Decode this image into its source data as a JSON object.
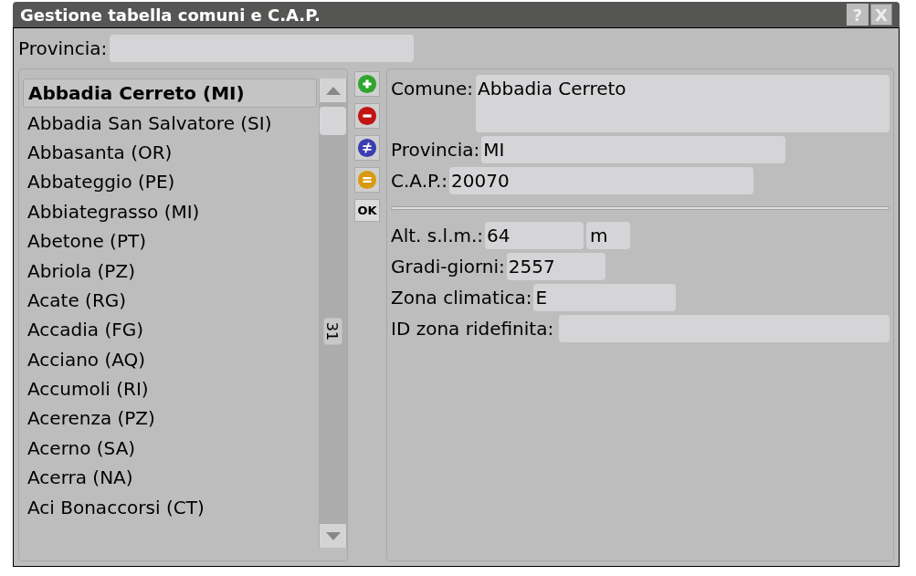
{
  "window": {
    "title": "Gestione tabella comuni e C.A.P.",
    "buttons": [
      {
        "kind": "help",
        "label": "?"
      },
      {
        "kind": "close",
        "label": "X"
      }
    ]
  },
  "filter": {
    "label": "Provincia:"
  },
  "list": {
    "items": [
      {
        "label": "Abbadia Cerreto (MI)",
        "selected": true
      },
      {
        "label": "Abbadia San Salvatore (SI)",
        "selected": false
      },
      {
        "label": "Abbasanta (OR)",
        "selected": false
      },
      {
        "label": "Abbateggio (PE)",
        "selected": false
      },
      {
        "label": "Abbiategrasso (MI)",
        "selected": false
      },
      {
        "label": "Abetone (PT)",
        "selected": false
      },
      {
        "label": "Abriola (PZ)",
        "selected": false
      },
      {
        "label": "Acate (RG)",
        "selected": false
      },
      {
        "label": "Accadia (FG)",
        "selected": false
      },
      {
        "label": "Acciano (AQ)",
        "selected": false
      },
      {
        "label": "Accumoli (RI)",
        "selected": false
      },
      {
        "label": "Acerenza (PZ)",
        "selected": false
      },
      {
        "label": "Acerno (SA)",
        "selected": false
      },
      {
        "label": "Acerra (NA)",
        "selected": false
      },
      {
        "label": "Aci Bonaccorsi (CT)",
        "selected": false
      }
    ],
    "scroll_marker": "31"
  },
  "actions": [
    {
      "kind": "add"
    },
    {
      "kind": "remove"
    },
    {
      "kind": "replace"
    },
    {
      "kind": "equal"
    },
    {
      "kind": "ok",
      "label": "OK"
    }
  ],
  "details": {
    "comune": {
      "label": "Comune:",
      "value": "Abbadia Cerreto"
    },
    "provincia": {
      "label": "Provincia:",
      "value": "MI"
    },
    "cap": {
      "label": "C.A.P.:",
      "value": "20070"
    },
    "altitude": {
      "label": "Alt. s.l.m.:",
      "value": "64",
      "unit": "m"
    },
    "gradi_giorni": {
      "label": "Gradi-giorni:",
      "value": "2557"
    },
    "zona_climatica": {
      "label": "Zona climatica:",
      "value": "E"
    },
    "id_zona": {
      "label": "ID zona ridefinita:"
    }
  }
}
